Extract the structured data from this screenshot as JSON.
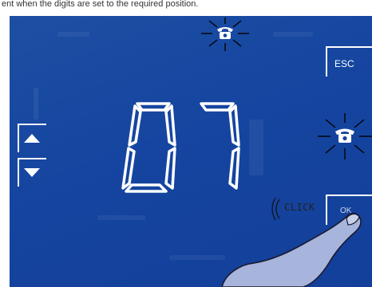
{
  "caption": "ent when the digits are set to the required position.",
  "buttons": {
    "esc_label": "ESC",
    "ok_label": "OK",
    "up_arrow": "up-arrow",
    "down_arrow": "down-arrow"
  },
  "display": {
    "value": "07"
  },
  "annotation": {
    "click_label": "CLICK"
  },
  "icons": {
    "phone_top": "phone-icon",
    "phone_right": "phone-icon"
  },
  "colors": {
    "screen": "#1545a0",
    "segment": "#ffffff",
    "hand": "#a7b4dc"
  }
}
